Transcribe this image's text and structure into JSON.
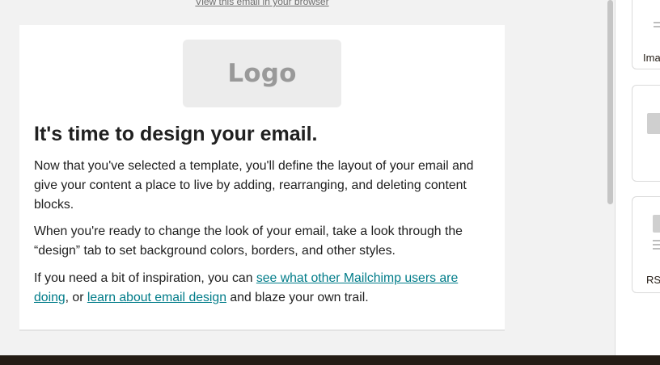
{
  "preview": {
    "browser_link": "View this email in your browser"
  },
  "email": {
    "logo_text": "Logo",
    "headline": "It's time to design your email.",
    "paragraph1": "Now that you've selected a template, you'll define the layout of your email and give your content a place to live by adding, rearranging, and deleting content blocks.",
    "paragraph2": "When you're ready to change the look of your email, take a look through the “design” tab to set background colors, borders, and other styles.",
    "paragraph3": {
      "before": "If you need a bit of inspiration, you can ",
      "link1": "see what other Mailchimp users are doing",
      "middle": ", or ",
      "link2": "learn about email design",
      "after": " and blaze your own trail."
    }
  },
  "sidebar": {
    "tiles": [
      {
        "label": "Ima",
        "icon": "image-icon"
      },
      {
        "label": "",
        "icon": "button-block-icon"
      },
      {
        "label": "RS",
        "icon": "rss-icon"
      }
    ]
  },
  "colors": {
    "link": "#007c89",
    "bottom_bar": "#241c15",
    "toggle_active": "#dbeaf0"
  }
}
